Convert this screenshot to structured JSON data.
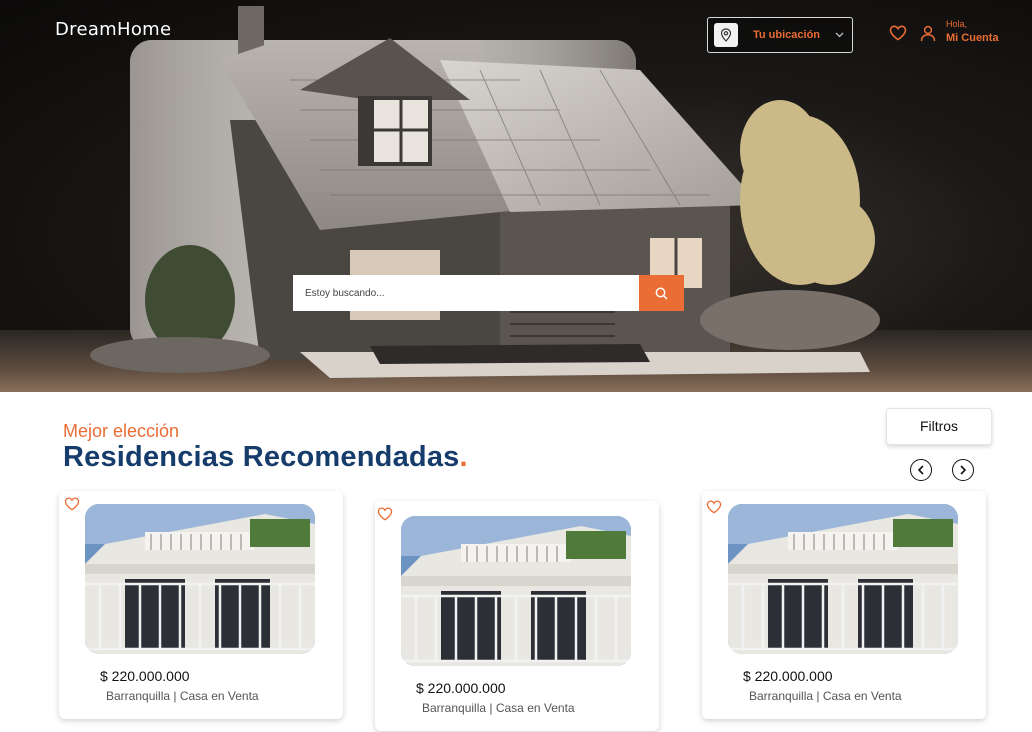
{
  "header": {
    "logo": "DreamHome",
    "location_label": "Tu ubicación",
    "greeting": "Hola,",
    "account_label": "Mi Cuenta"
  },
  "search": {
    "placeholder": "Estoy buscando..."
  },
  "section": {
    "eyebrow": "Mejor elección",
    "title": "Residencias Recomendadas",
    "title_dot": ".",
    "filters_label": "Filtros"
  },
  "listings": [
    {
      "price": "$ 220.000.000",
      "location": "Barranquilla",
      "type": "Casa en Venta"
    },
    {
      "price": "$ 220.000.000",
      "location": "Barranquilla",
      "type": "Casa en Venta"
    },
    {
      "price": "$ 220.000.000",
      "location": "Barranquilla",
      "type": "Casa en Venta"
    }
  ],
  "colors": {
    "accent": "#ea6d35",
    "title": "#163c6b",
    "hero_dark": "#1b1917"
  },
  "icons": {
    "location": "map-pin-icon",
    "dropdown": "chevron-down-icon",
    "favorites": "heart-icon",
    "user": "user-icon",
    "search": "search-icon",
    "prev": "chevron-left-icon",
    "next": "chevron-right-icon"
  }
}
